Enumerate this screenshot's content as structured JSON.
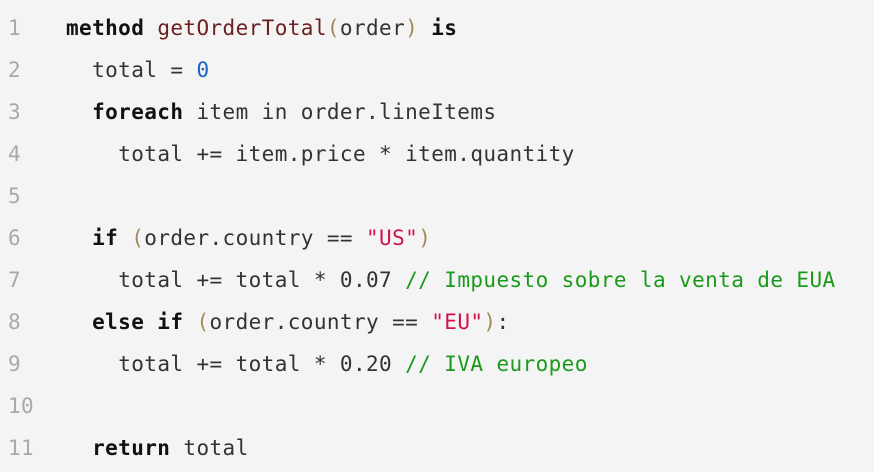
{
  "lines": [
    {
      "no": "1"
    },
    {
      "no": "2"
    },
    {
      "no": "3"
    },
    {
      "no": "4"
    },
    {
      "no": "5"
    },
    {
      "no": "6"
    },
    {
      "no": "7"
    },
    {
      "no": "8"
    },
    {
      "no": "9"
    },
    {
      "no": "10"
    },
    {
      "no": "11"
    }
  ],
  "code": {
    "l1": {
      "kw1": "method",
      "fn": "getOrderTotal",
      "p1": "(",
      "arg": "order",
      "p2": ")",
      "kw2": "is"
    },
    "l2": {
      "indent": "  ",
      "t1": "total = ",
      "num": "0"
    },
    "l3": {
      "indent": "  ",
      "kw": "foreach",
      "t1": " item in order.lineItems"
    },
    "l4": {
      "indent": "    ",
      "t1": "total += item.price * item.quantity"
    },
    "l6": {
      "indent": "  ",
      "kw": "if",
      "p1": " (",
      "t1": "order.country == ",
      "str": "\"US\"",
      "p2": ")"
    },
    "l7": {
      "indent": "    ",
      "t1": "total += total * 0.07 ",
      "cm": "// Impuesto sobre la venta de EUA"
    },
    "l8": {
      "indent": "  ",
      "kw": "else if",
      "p1": " (",
      "t1": "order.country == ",
      "str": "\"EU\"",
      "p2": ")",
      "t2": ":"
    },
    "l9": {
      "indent": "    ",
      "t1": "total += total * 0.20 ",
      "cm": "// IVA europeo"
    },
    "l11": {
      "indent": "  ",
      "kw": "return",
      "t1": " total"
    }
  }
}
